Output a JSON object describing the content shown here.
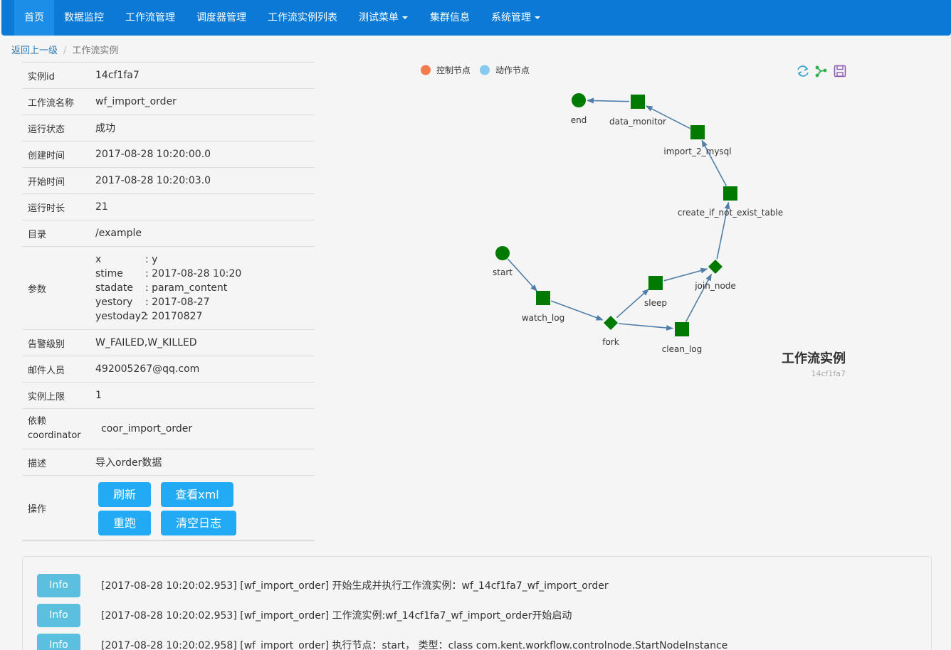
{
  "nav": {
    "items": [
      {
        "label": "首页"
      },
      {
        "label": "数据监控"
      },
      {
        "label": "工作流管理"
      },
      {
        "label": "调度器管理"
      },
      {
        "label": "工作流实例列表"
      },
      {
        "label": "测试菜单"
      },
      {
        "label": "集群信息"
      },
      {
        "label": "系统管理"
      }
    ]
  },
  "breadcrumb": {
    "back": "返回上一级",
    "separator": "/",
    "current": "工作流实例"
  },
  "info": {
    "rows": [
      {
        "label": "实例id",
        "value": "14cf1fa7"
      },
      {
        "label": "工作流名称",
        "value": "wf_import_order"
      },
      {
        "label": "运行状态",
        "value": "成功"
      },
      {
        "label": "创建时间",
        "value": "2017-08-28 10:20:00.0"
      },
      {
        "label": "开始时间",
        "value": "2017-08-28 10:20:03.0"
      },
      {
        "label": "运行时长",
        "value": "21"
      },
      {
        "label": "目录",
        "value": "/example"
      }
    ],
    "params_label": "参数",
    "params": [
      {
        "key": "x",
        "value": ": y"
      },
      {
        "key": "stime",
        "value": ": 2017-08-28 10:20"
      },
      {
        "key": "stadate",
        "value": ": param_content"
      },
      {
        "key": "yestory",
        "value": ": 2017-08-27"
      },
      {
        "key": "yestoday2",
        "value": ": 20170827"
      }
    ],
    "rows2": [
      {
        "label": "告警级别",
        "value": "W_FAILED,W_KILLED"
      },
      {
        "label": "邮件人员",
        "value": "492005267@qq.com"
      },
      {
        "label": "实例上限",
        "value": "1"
      }
    ],
    "dep_label_1": "依赖",
    "dep_label_2": "coordinator",
    "dep_value": "coor_import_order",
    "desc_label": "描述",
    "desc_value": "导入order数据",
    "ops_label": "操作",
    "buttons": {
      "refresh": "刷新",
      "view_xml": "查看xml",
      "rerun": "重跑",
      "clear_log": "清空日志"
    }
  },
  "graph": {
    "legend": {
      "control": "控制节点",
      "action": "动作节点"
    },
    "title": "工作流实例",
    "subtitle": "14cf1fa7",
    "colors": {
      "control": "#f47b4e",
      "action": "#88c9f0",
      "node": "#007a00",
      "edge": "#4f7fa8"
    },
    "nodes": [
      {
        "id": "start",
        "label": "start",
        "shape": "circle"
      },
      {
        "id": "watch_log",
        "label": "watch_log",
        "shape": "square"
      },
      {
        "id": "fork",
        "label": "fork",
        "shape": "diamond"
      },
      {
        "id": "sleep",
        "label": "sleep",
        "shape": "square"
      },
      {
        "id": "clean_log",
        "label": "clean_log",
        "shape": "square"
      },
      {
        "id": "join_node",
        "label": "join_node",
        "shape": "diamond"
      },
      {
        "id": "create_if_not_exist_table",
        "label": "create_if_not_exist_table",
        "shape": "square"
      },
      {
        "id": "import_2_mysql",
        "label": "import_2_mysql",
        "shape": "square"
      },
      {
        "id": "data_monitor",
        "label": "data_monitor",
        "shape": "square"
      },
      {
        "id": "end",
        "label": "end",
        "shape": "circle"
      }
    ],
    "edges": [
      [
        "start",
        "watch_log"
      ],
      [
        "watch_log",
        "fork"
      ],
      [
        "fork",
        "sleep"
      ],
      [
        "fork",
        "clean_log"
      ],
      [
        "sleep",
        "join_node"
      ],
      [
        "clean_log",
        "join_node"
      ],
      [
        "join_node",
        "create_if_not_exist_table"
      ],
      [
        "create_if_not_exist_table",
        "import_2_mysql"
      ],
      [
        "import_2_mysql",
        "data_monitor"
      ],
      [
        "data_monitor",
        "end"
      ]
    ],
    "tools": [
      "refresh-icon",
      "graph-layout-icon",
      "save-icon"
    ]
  },
  "logs": [
    {
      "level": "Info",
      "text": "[2017-08-28 10:20:02.953] [wf_import_order] 开始生成并执行工作流实例：wf_14cf1fa7_wf_import_order"
    },
    {
      "level": "Info",
      "text": "[2017-08-28 10:20:02.953] [wf_import_order] 工作流实例:wf_14cf1fa7_wf_import_order开始启动"
    },
    {
      "level": "Info",
      "text": "[2017-08-28 10:20:02.958] [wf_import_order] 执行节点：start， 类型：class com.kent.workflow.controlnode.StartNodeInstance"
    }
  ]
}
